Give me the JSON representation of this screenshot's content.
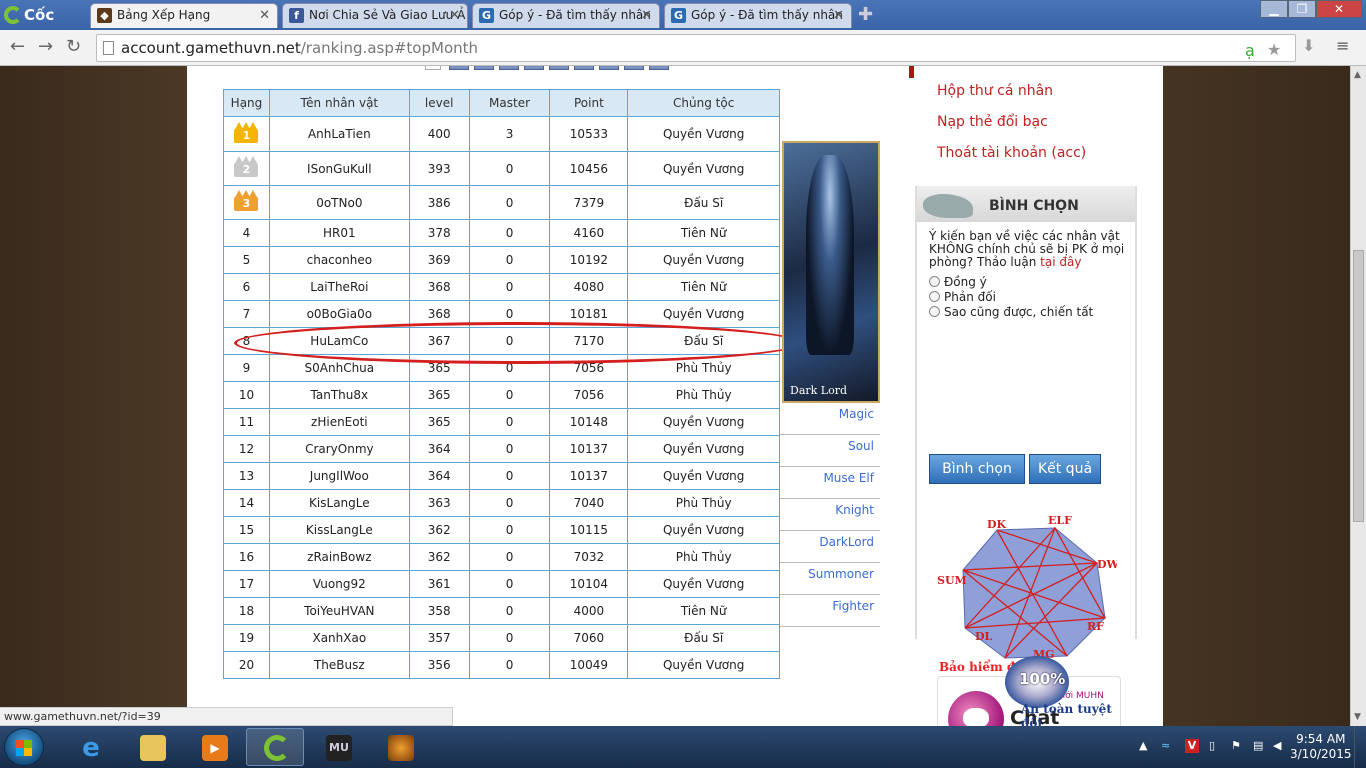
{
  "browser": {
    "brand": "Cốc Cốc",
    "tabs": [
      {
        "title": "Bảng Xếp Hạng",
        "active": true
      },
      {
        "title": "Nơi Chia Sẻ Và Giao Lưu Ả",
        "active": false
      },
      {
        "title": "Góp ý - Đã tìm thấy nhân",
        "active": false
      },
      {
        "title": "Góp ý - Đã tìm thấy nhân",
        "active": false
      }
    ],
    "url_host": "account.gamethuvn.net",
    "url_path": "/ranking.asp#topMonth",
    "status_url": "www.gamethuvn.net/?id=39"
  },
  "ranking": {
    "headers": [
      "Hạng",
      "Tên nhân vật",
      "level",
      "Master",
      "Point",
      "Chủng tộc"
    ],
    "rows": [
      {
        "rank": "1",
        "name": "AnhLaTien",
        "level": "400",
        "master": "3",
        "point": "10533",
        "race": "Quyền Vương",
        "rc": "rv"
      },
      {
        "rank": "2",
        "name": "ISonGuKull",
        "level": "393",
        "master": "0",
        "point": "10456",
        "race": "Quyền Vương",
        "rc": "rv"
      },
      {
        "rank": "3",
        "name": "0oTNo0",
        "level": "386",
        "master": "0",
        "point": "7379",
        "race": "Đấu Sĩ",
        "rc": "ds"
      },
      {
        "rank": "4",
        "name": "HR01",
        "level": "378",
        "master": "0",
        "point": "4160",
        "race": "Tiên Nữ",
        "rc": "tn"
      },
      {
        "rank": "5",
        "name": "chaconheo",
        "level": "369",
        "master": "0",
        "point": "10192",
        "race": "Quyền Vương",
        "rc": "rv"
      },
      {
        "rank": "6",
        "name": "LaiTheRoi",
        "level": "368",
        "master": "0",
        "point": "4080",
        "race": "Tiên Nữ",
        "rc": "tn"
      },
      {
        "rank": "7",
        "name": "o0BoGia0o",
        "level": "368",
        "master": "0",
        "point": "10181",
        "race": "Quyền Vương",
        "rc": "rv"
      },
      {
        "rank": "8",
        "name": "HuLamCo",
        "level": "367",
        "master": "0",
        "point": "7170",
        "race": "Đấu Sĩ",
        "rc": "ds"
      },
      {
        "rank": "9",
        "name": "S0AnhChua",
        "level": "365",
        "master": "0",
        "point": "7056",
        "race": "Phù Thủy",
        "rc": "pt"
      },
      {
        "rank": "10",
        "name": "TanThu8x",
        "level": "365",
        "master": "0",
        "point": "7056",
        "race": "Phù Thủy",
        "rc": "pt"
      },
      {
        "rank": "11",
        "name": "zHienEoti",
        "level": "365",
        "master": "0",
        "point": "10148",
        "race": "Quyền Vương",
        "rc": "rv"
      },
      {
        "rank": "12",
        "name": "CraryOnmy",
        "level": "364",
        "master": "0",
        "point": "10137",
        "race": "Quyền Vương",
        "rc": "rv"
      },
      {
        "rank": "13",
        "name": "JungIlWoo",
        "level": "364",
        "master": "0",
        "point": "10137",
        "race": "Quyền Vương",
        "rc": "rv"
      },
      {
        "rank": "14",
        "name": "KisLangLe",
        "level": "363",
        "master": "0",
        "point": "7040",
        "race": "Phù Thủy",
        "rc": "pt"
      },
      {
        "rank": "15",
        "name": "KissLangLe",
        "level": "362",
        "master": "0",
        "point": "10115",
        "race": "Quyền Vương",
        "rc": "rv"
      },
      {
        "rank": "16",
        "name": "zRainBowz",
        "level": "362",
        "master": "0",
        "point": "7032",
        "race": "Phù Thủy",
        "rc": "pt"
      },
      {
        "rank": "17",
        "name": "Vuong92",
        "level": "361",
        "master": "0",
        "point": "10104",
        "race": "Quyền Vương",
        "rc": "rv"
      },
      {
        "rank": "18",
        "name": "ToiYeuHVAN",
        "level": "358",
        "master": "0",
        "point": "4000",
        "race": "Tiên Nữ",
        "rc": "tn"
      },
      {
        "rank": "19",
        "name": "XanhXao",
        "level": "357",
        "master": "0",
        "point": "7060",
        "race": "Đấu Sĩ",
        "rc": "ds"
      },
      {
        "rank": "20",
        "name": "TheBusz",
        "level": "356",
        "master": "0",
        "point": "10049",
        "race": "Quyền Vương",
        "rc": "rv"
      }
    ]
  },
  "portrait_caption": "Dark Lord",
  "classes": [
    "Magic",
    "Soul",
    "Muse Elf",
    "Knight",
    "DarkLord",
    "Summoner",
    "Fighter"
  ],
  "account_menu": [
    "Hộp thư cá nhân",
    "Nạp thẻ đổi bạc",
    "Thoát tài khoản (acc)"
  ],
  "poll": {
    "title": "BÌNH CHỌN",
    "question": "Ý kiến bạn về việc các nhân vật KHÔNG chính chủ sẽ bị PK ở mọi phòng? Thảo luận",
    "question_link": "tại đây",
    "options": [
      "Đồng ý",
      "Phản đối",
      "Sao cũng được, chiến tất"
    ],
    "vote_label": "Bình chọn",
    "result_label": "Kết quả"
  },
  "diagram_labels": [
    "DK",
    "ELF",
    "DW",
    "RF",
    "MG",
    "DL",
    "SUM"
  ],
  "chat": {
    "sub": "Kênh thế giới MUHN",
    "title": "Chat Server"
  },
  "insurance": {
    "line1": "Bảo hiểm đồ",
    "badge": "100%",
    "line2": "An toàn tuyệt đối"
  },
  "taskbar": {
    "time": "9:54 AM",
    "date": "3/10/2015"
  }
}
